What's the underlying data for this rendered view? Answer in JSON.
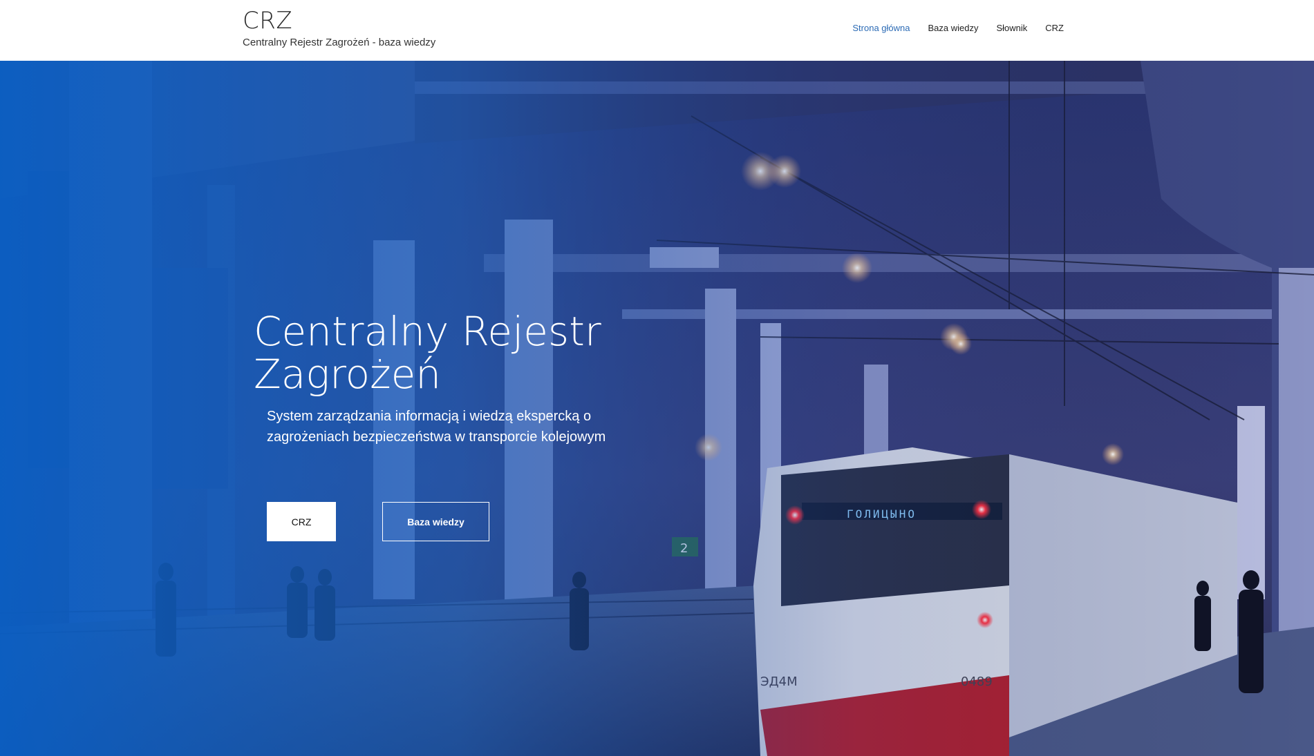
{
  "header": {
    "brand_title": "CRZ",
    "brand_subtitle": "Centralny Rejestr Zagrożeń - baza wiedzy",
    "nav": [
      {
        "label": "Strona główna",
        "active": true
      },
      {
        "label": "Baza wiedzy",
        "active": false
      },
      {
        "label": "Słownik",
        "active": false
      },
      {
        "label": "CRZ",
        "active": false
      }
    ]
  },
  "hero": {
    "title": "Centralny Rejestr Zagrożeń",
    "description": "System zarządzania informacją i wiedzą ekspercką o zagrożeniach bezpieczeństwa w transporcie kolejowym",
    "primary_button": "CRZ",
    "secondary_button": "Baza wiedzy",
    "image": "night-railway-station-train-photo",
    "train_destination_sign": "ГОЛИЦЫНО",
    "train_number": "0489",
    "train_model": "ЭД4М",
    "platform_sign": "2"
  },
  "colors": {
    "accent": "#2c6bb5",
    "overlay_blue": "#0a5fc4",
    "nav_text": "#222222"
  }
}
